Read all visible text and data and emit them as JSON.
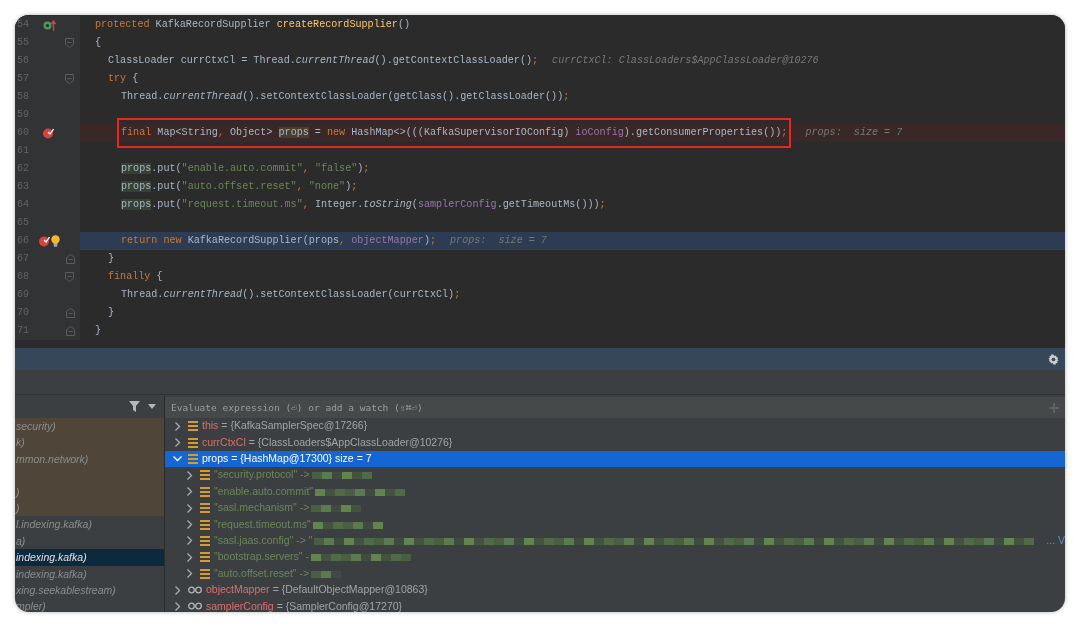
{
  "editor": {
    "lines": [
      {
        "number": "54",
        "override_marker": true,
        "bulb": false,
        "fold_start": false,
        "fold_end": false,
        "breakpoint": false,
        "execution": false,
        "boxed": false,
        "tokens": [
          {
            "kind": "kw",
            "text": "protected "
          },
          {
            "kind": "plain",
            "text": "KafkaRecordSupplier "
          },
          {
            "kind": "decl",
            "text": "createRecordSupplier"
          },
          {
            "kind": "plain",
            "text": "()"
          }
        ]
      },
      {
        "number": "55",
        "override_marker": false,
        "bulb": false,
        "fold_start": true,
        "fold_end": false,
        "breakpoint": false,
        "execution": false,
        "boxed": false,
        "tokens": [
          {
            "kind": "plain",
            "text": "{"
          }
        ]
      },
      {
        "number": "56",
        "override_marker": false,
        "bulb": false,
        "fold_start": false,
        "fold_end": false,
        "breakpoint": false,
        "execution": false,
        "boxed": false,
        "tokens": [
          {
            "kind": "plain",
            "text": "ClassLoader currCtxCl = Thread."
          },
          {
            "kind": "static",
            "text": "currentThread"
          },
          {
            "kind": "plain",
            "text": "().getContextClassLoader()"
          },
          {
            "kind": "kw",
            "text": ";"
          }
        ],
        "hint": "currCtxCl: ClassLoaders$AppClassLoader@10276"
      },
      {
        "number": "57",
        "override_marker": false,
        "bulb": false,
        "fold_start": true,
        "fold_end": false,
        "breakpoint": false,
        "execution": false,
        "boxed": false,
        "tokens": [
          {
            "kind": "kw",
            "text": "try "
          },
          {
            "kind": "plain",
            "text": "{"
          }
        ]
      },
      {
        "number": "58",
        "override_marker": false,
        "bulb": false,
        "fold_start": false,
        "fold_end": false,
        "breakpoint": false,
        "execution": false,
        "boxed": false,
        "tokens": [
          {
            "kind": "plain",
            "text": "Thread."
          },
          {
            "kind": "static",
            "text": "currentThread"
          },
          {
            "kind": "plain",
            "text": "().setContextClassLoader(getClass().getClassLoader())"
          },
          {
            "kind": "kw",
            "text": ";"
          }
        ]
      },
      {
        "number": "59",
        "override_marker": false,
        "bulb": false,
        "fold_start": false,
        "fold_end": false,
        "breakpoint": false,
        "execution": false,
        "boxed": false
      },
      {
        "number": "60",
        "override_marker": false,
        "bulb": false,
        "fold_start": false,
        "fold_end": false,
        "breakpoint": true,
        "execution": false,
        "boxed": true,
        "tokens": [
          {
            "kind": "kw",
            "text": "final "
          },
          {
            "kind": "plain",
            "text": "Map<String"
          },
          {
            "kind": "kw",
            "text": ", "
          },
          {
            "kind": "plain",
            "text": "Object> "
          },
          {
            "kind": "write",
            "text": "props"
          },
          {
            "kind": "plain",
            "text": " = "
          },
          {
            "kind": "kw",
            "text": "new "
          },
          {
            "kind": "plain",
            "text": "HashMap<>(((KafkaSupervisorIOConfig) "
          },
          {
            "kind": "field",
            "text": "ioConfig"
          },
          {
            "kind": "plain",
            "text": ").getConsumerProperties())"
          },
          {
            "kind": "kw",
            "text": ";"
          }
        ],
        "hint": "props:  size = 7"
      },
      {
        "number": "61",
        "override_marker": false,
        "bulb": false,
        "fold_start": false,
        "fold_end": false,
        "breakpoint": false,
        "execution": false,
        "boxed": false
      },
      {
        "number": "62",
        "override_marker": false,
        "bulb": false,
        "fold_start": false,
        "fold_end": false,
        "breakpoint": false,
        "execution": false,
        "boxed": false,
        "tokens": [
          {
            "kind": "read",
            "text": "props"
          },
          {
            "kind": "plain",
            "text": ".put("
          },
          {
            "kind": "str",
            "text": "\"enable.auto.commit\""
          },
          {
            "kind": "kw",
            "text": ", "
          },
          {
            "kind": "str",
            "text": "\"false\""
          },
          {
            "kind": "plain",
            "text": ")"
          },
          {
            "kind": "kw",
            "text": ";"
          }
        ]
      },
      {
        "number": "63",
        "override_marker": false,
        "bulb": false,
        "fold_start": false,
        "fold_end": false,
        "breakpoint": false,
        "execution": false,
        "boxed": false,
        "tokens": [
          {
            "kind": "read",
            "text": "props"
          },
          {
            "kind": "plain",
            "text": ".put("
          },
          {
            "kind": "str",
            "text": "\"auto.offset.reset\""
          },
          {
            "kind": "kw",
            "text": ", "
          },
          {
            "kind": "str",
            "text": "\"none\""
          },
          {
            "kind": "plain",
            "text": ")"
          },
          {
            "kind": "kw",
            "text": ";"
          }
        ]
      },
      {
        "number": "64",
        "override_marker": false,
        "bulb": false,
        "fold_start": false,
        "fold_end": false,
        "breakpoint": false,
        "execution": false,
        "boxed": false,
        "tokens": [
          {
            "kind": "read",
            "text": "props"
          },
          {
            "kind": "plain",
            "text": ".put("
          },
          {
            "kind": "str",
            "text": "\"request.timeout.ms\""
          },
          {
            "kind": "kw",
            "text": ", "
          },
          {
            "kind": "plain",
            "text": "Integer."
          },
          {
            "kind": "static",
            "text": "toString"
          },
          {
            "kind": "plain",
            "text": "("
          },
          {
            "kind": "field",
            "text": "samplerConfig"
          },
          {
            "kind": "plain",
            "text": ".getTimeoutMs()))"
          },
          {
            "kind": "kw",
            "text": ";"
          }
        ]
      },
      {
        "number": "65",
        "override_marker": false,
        "bulb": false,
        "fold_start": false,
        "fold_end": false,
        "breakpoint": false,
        "execution": false,
        "boxed": false
      },
      {
        "number": "66",
        "override_marker": false,
        "bulb": true,
        "fold_start": false,
        "fold_end": false,
        "breakpoint": true,
        "execution": true,
        "boxed": false,
        "tokens": [
          {
            "kind": "kw",
            "text": "return new "
          },
          {
            "kind": "plain",
            "text": "KafkaRecordSupplier(props"
          },
          {
            "kind": "kw",
            "text": ", "
          },
          {
            "kind": "field",
            "text": "objectMapper"
          },
          {
            "kind": "plain",
            "text": ")"
          },
          {
            "kind": "kw",
            "text": ";"
          }
        ],
        "hint": "props:  size = 7"
      },
      {
        "number": "67",
        "override_marker": false,
        "bulb": false,
        "fold_start": false,
        "fold_end": true,
        "breakpoint": false,
        "execution": false,
        "boxed": false,
        "tokens": [
          {
            "kind": "plain",
            "text": "}"
          }
        ]
      },
      {
        "number": "68",
        "override_marker": false,
        "bulb": false,
        "fold_start": true,
        "fold_end": false,
        "breakpoint": false,
        "execution": false,
        "boxed": false,
        "tokens": [
          {
            "kind": "kw",
            "text": "finally "
          },
          {
            "kind": "plain",
            "text": "{"
          }
        ]
      },
      {
        "number": "69",
        "override_marker": false,
        "bulb": false,
        "fold_start": false,
        "fold_end": false,
        "breakpoint": false,
        "execution": false,
        "boxed": false,
        "tokens": [
          {
            "kind": "plain",
            "text": "Thread."
          },
          {
            "kind": "static",
            "text": "currentThread"
          },
          {
            "kind": "plain",
            "text": "().setContextClassLoader(currCtxCl)"
          },
          {
            "kind": "kw",
            "text": ";"
          }
        ]
      },
      {
        "number": "70",
        "override_marker": false,
        "bulb": false,
        "fold_start": false,
        "fold_end": true,
        "breakpoint": false,
        "execution": false,
        "boxed": false,
        "tokens": [
          {
            "kind": "plain",
            "text": "}"
          }
        ]
      },
      {
        "number": "71",
        "override_marker": false,
        "bulb": false,
        "fold_start": false,
        "fold_end": true,
        "breakpoint": false,
        "execution": false,
        "boxed": false,
        "tokens": [
          {
            "kind": "plain",
            "text": "}"
          }
        ]
      }
    ]
  },
  "frames": [
    {
      "text": "security)",
      "library": true,
      "selected": false
    },
    {
      "text": "k)",
      "library": true,
      "selected": false
    },
    {
      "text": "mmon.network)",
      "library": true,
      "selected": false
    },
    {
      "library": true,
      "selected": false
    },
    {
      "text": ")",
      "library": true,
      "selected": false
    },
    {
      "text": ")",
      "library": true,
      "selected": false
    },
    {
      "text": "l.indexing.kafka)",
      "library": false,
      "selected": false
    },
    {
      "text": "a)",
      "library": false,
      "selected": false
    },
    {
      "text": "indexing.kafka)",
      "library": false,
      "selected": true
    },
    {
      "text": "indexing.kafka)",
      "library": false,
      "selected": false
    },
    {
      "text": "xing.seekablestream)",
      "library": false,
      "selected": false
    },
    {
      "text": "mpler)",
      "library": false,
      "selected": false
    }
  ],
  "evaluate": {
    "placeholder": "Evaluate expression (⏎) or add a watch (⇧⌘⏎)"
  },
  "variables": [
    {
      "kind": "field",
      "name": "this",
      "value": "= {KafkaSamplerSpec@17266}",
      "expanded": false,
      "selected": false
    },
    {
      "kind": "field",
      "name": "currCtxCl",
      "value": "= {ClassLoaders$AppClassLoader@10276}",
      "expanded": false,
      "selected": false
    },
    {
      "kind": "field",
      "name": "props",
      "value": "= {HashMap@17300}  size = 7",
      "expanded": true,
      "selected": true,
      "children": [
        {
          "key": "\"security.protocol\" ->",
          "expanded": false
        },
        {
          "key": "\"enable.auto.commit\"",
          "expanded": false
        },
        {
          "key": "\"sasl.mechanism\" ->",
          "expanded": false
        },
        {
          "key": "\"request.timeout.ms\"",
          "expanded": false
        },
        {
          "key": "\"sasl.jaas.config\" -> \"",
          "expanded": false,
          "more": "... V"
        },
        {
          "key": "\"bootstrap.servers\" -",
          "expanded": false
        },
        {
          "key": "\"auto.offset.reset\" ->",
          "expanded": false
        }
      ]
    },
    {
      "kind": "watch",
      "name": "objectMapper",
      "value": "= {DefaultObjectMapper@10863}",
      "expanded": false,
      "selected": false
    },
    {
      "kind": "watch",
      "name": "samplerConfig",
      "value": "= {SamplerConfig@17270}",
      "expanded": false,
      "selected": false
    }
  ]
}
